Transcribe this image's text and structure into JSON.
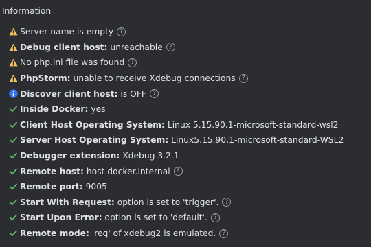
{
  "section": {
    "title": "Information"
  },
  "colors": {
    "warning": "#f2c55c",
    "info": "#3574f0",
    "check": "#5fb865",
    "background": "#2b2d30",
    "text": "#dfe1e5"
  },
  "rows": [
    {
      "icon": "warning-icon",
      "label": "",
      "value": "Server name is empty",
      "help": true
    },
    {
      "icon": "warning-icon",
      "label": "Debug client host:",
      "value": "unreachable",
      "help": true
    },
    {
      "icon": "warning-icon",
      "label": "",
      "value": "No php.ini file was found",
      "help": true
    },
    {
      "icon": "warning-icon",
      "label": "PhpStorm:",
      "value": "unable to receive Xdebug connections",
      "help": true
    },
    {
      "icon": "info-icon",
      "label": "Discover client host:",
      "value": "is OFF",
      "help": true
    },
    {
      "icon": "check-icon",
      "label": "Inside Docker:",
      "value": "yes",
      "help": false
    },
    {
      "icon": "check-icon",
      "label": "Client Host Operating System:",
      "value": "Linux 5.15.90.1-microsoft-standard-wsl2",
      "help": false
    },
    {
      "icon": "check-icon",
      "label": "Server Host Operating System:",
      "value": "Linux5.15.90.1-microsoft-standard-WSL2",
      "help": false
    },
    {
      "icon": "check-icon",
      "label": "Debugger extension:",
      "value": "Xdebug 3.2.1",
      "help": false
    },
    {
      "icon": "check-icon",
      "label": "Remote host:",
      "value": "host.docker.internal",
      "help": true
    },
    {
      "icon": "check-icon",
      "label": "Remote port:",
      "value": "9005",
      "help": false
    },
    {
      "icon": "check-icon",
      "label": "Start With Request:",
      "value": "option is set to 'trigger'.",
      "help": true
    },
    {
      "icon": "check-icon",
      "label": "Start Upon Error:",
      "value": "option is set to 'default'.",
      "help": true
    },
    {
      "icon": "check-icon",
      "label": "Remote mode:",
      "value": "'req' of xdebug2 is emulated.",
      "help": true
    }
  ],
  "help_glyph": "?"
}
